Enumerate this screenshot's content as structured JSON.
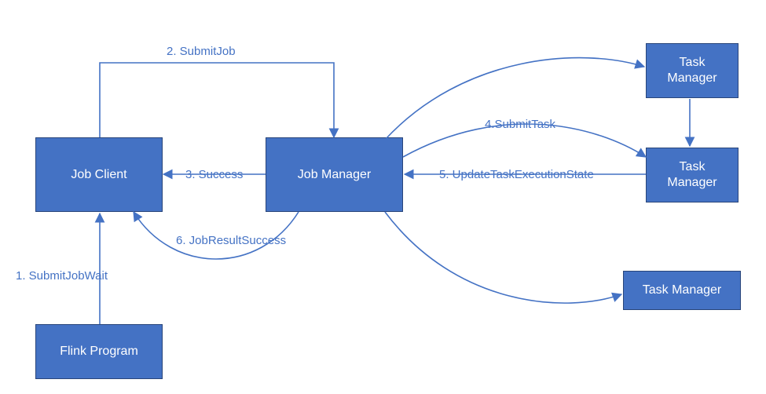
{
  "colors": {
    "node_fill": "#4472C4",
    "edge": "#4472C4",
    "text_on_node": "#ffffff"
  },
  "nodes": {
    "flink_program": {
      "label": "Flink Program"
    },
    "job_client": {
      "label": "Job Client"
    },
    "job_manager": {
      "label": "Job Manager"
    },
    "task_manager_1": {
      "label": "Task\nManager"
    },
    "task_manager_2": {
      "label": "Task\nManager"
    },
    "task_manager_3": {
      "label": "Task Manager"
    }
  },
  "edges": {
    "e1": {
      "label": "1. SubmitJobWait",
      "from": "flink_program",
      "to": "job_client"
    },
    "e2": {
      "label": "2. SubmitJob",
      "from": "job_client",
      "to": "job_manager"
    },
    "e3": {
      "label": "3. Success",
      "from": "job_manager",
      "to": "job_client"
    },
    "e4": {
      "label": "4.SubmitTask",
      "from": "job_manager",
      "to": "task_manager_2"
    },
    "e5": {
      "label": "5. UpdateTaskExecutionState",
      "from": "task_manager_2",
      "to": "job_manager"
    },
    "e6": {
      "label": "6. JobResultSuccess",
      "from": "job_manager",
      "to": "job_client"
    },
    "tm1_to_tm2": {
      "label": "",
      "from": "task_manager_1",
      "to": "task_manager_2"
    },
    "jm_to_tm1": {
      "label": "",
      "from": "job_manager",
      "to": "task_manager_1"
    },
    "jm_to_tm3": {
      "label": "",
      "from": "job_manager",
      "to": "task_manager_3"
    }
  }
}
